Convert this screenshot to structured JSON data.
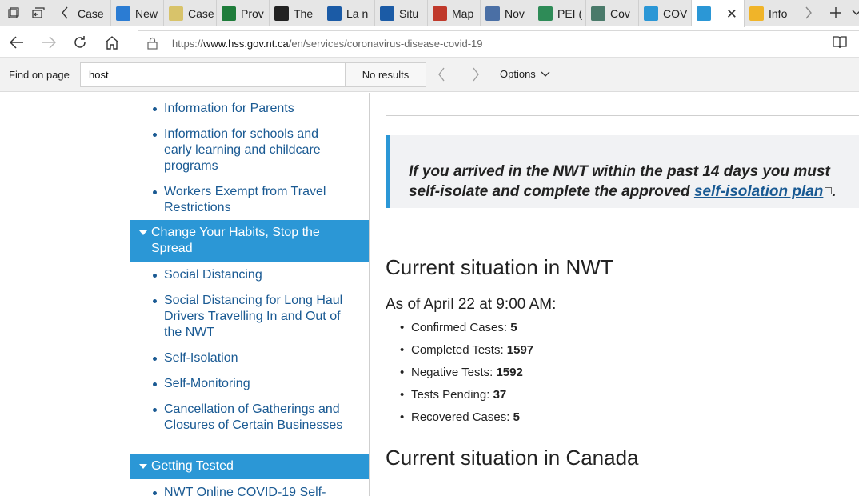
{
  "tabs": [
    {
      "label": "Case",
      "icon": "document-icon",
      "color": "#ffffff"
    },
    {
      "label": "New",
      "icon": "chart-icon",
      "color": "#2b7cd3"
    },
    {
      "label": "Case",
      "icon": "pencil-icon",
      "color": "#d8c36a"
    },
    {
      "label": "Prov",
      "icon": "sheet-icon",
      "color": "#1e7c3a"
    },
    {
      "label": "The",
      "icon": "shield-icon",
      "color": "#222222"
    },
    {
      "label": "La n",
      "icon": "fleur-icon",
      "color": "#1b5ba6"
    },
    {
      "label": "Situ",
      "icon": "fleur-icon",
      "color": "#1b5ba6"
    },
    {
      "label": "Map",
      "icon": "feather-icon",
      "color": "#c0392b"
    },
    {
      "label": "Nov",
      "icon": "image-icon",
      "color": "#4a6fa5"
    },
    {
      "label": "PEI (",
      "icon": "people-icon",
      "color": "#2e8b57"
    },
    {
      "label": "Cov",
      "icon": "globe-icon",
      "color": "#4a7a6a"
    },
    {
      "label": "COV",
      "icon": "badge-icon",
      "color": "#2b97d6"
    },
    {
      "label": "",
      "icon": "polar-bear-icon",
      "color": "#2b97d6",
      "active": true
    },
    {
      "label": "Info",
      "icon": "arc-icon",
      "color": "#f0b429"
    }
  ],
  "address": {
    "prefix": "https://",
    "host": "www.hss.gov.nt.ca",
    "path": "/en/services/coronavirus-disease-covid-19"
  },
  "find": {
    "label": "Find on page",
    "query": "host",
    "results": "No results",
    "options_label": "Options"
  },
  "sidebar": {
    "items_top": [
      {
        "label": "Information for Parents"
      },
      {
        "label": "Information for schools and early learning and childcare programs"
      },
      {
        "label": "Workers Exempt from Travel Restrictions"
      }
    ],
    "section_habits": "Change Your Habits, Stop the Spread",
    "items_habits": [
      {
        "label": "Social Distancing"
      },
      {
        "label": "Social Distancing for Long Haul Drivers Travelling In and Out of the NWT"
      },
      {
        "label": "Self-Isolation"
      },
      {
        "label": "Self-Monitoring"
      },
      {
        "label": "Cancellation of Gatherings and Closures of Certain Businesses"
      }
    ],
    "section_tested": "Getting Tested",
    "items_tested": [
      {
        "label": "NWT Online COVID-19 Self-"
      }
    ]
  },
  "main": {
    "callout_line1": "If you arrived in the NWT within the past 14 days you must",
    "callout_line2_prefix": "self-isolate and complete the approved ",
    "callout_link": "self-isolation plan",
    "callout_suffix": ".",
    "heading_nwt": "Current situation in NWT",
    "as_of": "As of April 22 at 9:00 AM:",
    "stats": [
      {
        "label": "Confirmed Cases: ",
        "value": "5"
      },
      {
        "label": "Completed Tests: ",
        "value": "1597"
      },
      {
        "label": "Negative Tests: ",
        "value": "1592"
      },
      {
        "label": "Tests Pending: ",
        "value": "37"
      },
      {
        "label": "Recovered Cases: ",
        "value": "5"
      }
    ],
    "heading_canada": "Current situation in Canada"
  }
}
